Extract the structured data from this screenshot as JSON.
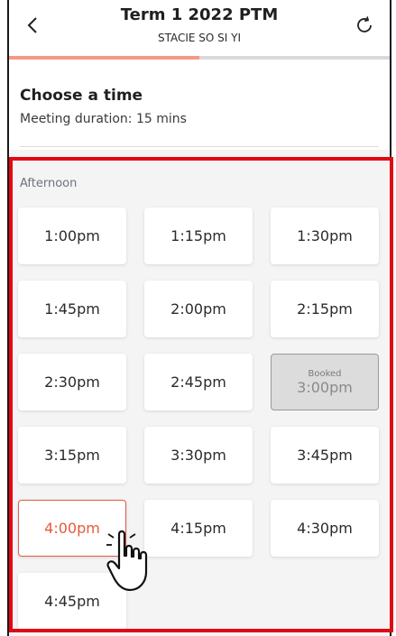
{
  "header": {
    "title": "Term 1 2022 PTM",
    "subtitle": "STACIE SO SI YI",
    "back_icon": "chevron-left-icon",
    "refresh_icon": "refresh-icon"
  },
  "progress": {
    "fraction": 0.5,
    "fill_color": "#f29a86",
    "track_color": "#d9d9dc"
  },
  "info": {
    "title": "Choose a time",
    "duration": "Meeting duration: 15 mins"
  },
  "section": {
    "label": "Afternoon"
  },
  "slots": [
    {
      "time": "1:00pm",
      "status": "available"
    },
    {
      "time": "1:15pm",
      "status": "available"
    },
    {
      "time": "1:30pm",
      "status": "available"
    },
    {
      "time": "1:45pm",
      "status": "available"
    },
    {
      "time": "2:00pm",
      "status": "available"
    },
    {
      "time": "2:15pm",
      "status": "available"
    },
    {
      "time": "2:30pm",
      "status": "available"
    },
    {
      "time": "2:45pm",
      "status": "available"
    },
    {
      "time": "3:00pm",
      "status": "booked",
      "tag": "Booked"
    },
    {
      "time": "3:15pm",
      "status": "available"
    },
    {
      "time": "3:30pm",
      "status": "available"
    },
    {
      "time": "3:45pm",
      "status": "available"
    },
    {
      "time": "4:00pm",
      "status": "selected"
    },
    {
      "time": "4:15pm",
      "status": "available"
    },
    {
      "time": "4:30pm",
      "status": "available"
    },
    {
      "time": "4:45pm",
      "status": "available"
    }
  ],
  "colors": {
    "accent": "#e8593c",
    "highlight": "#e30613",
    "booked_bg": "#dcdcdc"
  },
  "cursor_icon": "pointing-hand-icon"
}
